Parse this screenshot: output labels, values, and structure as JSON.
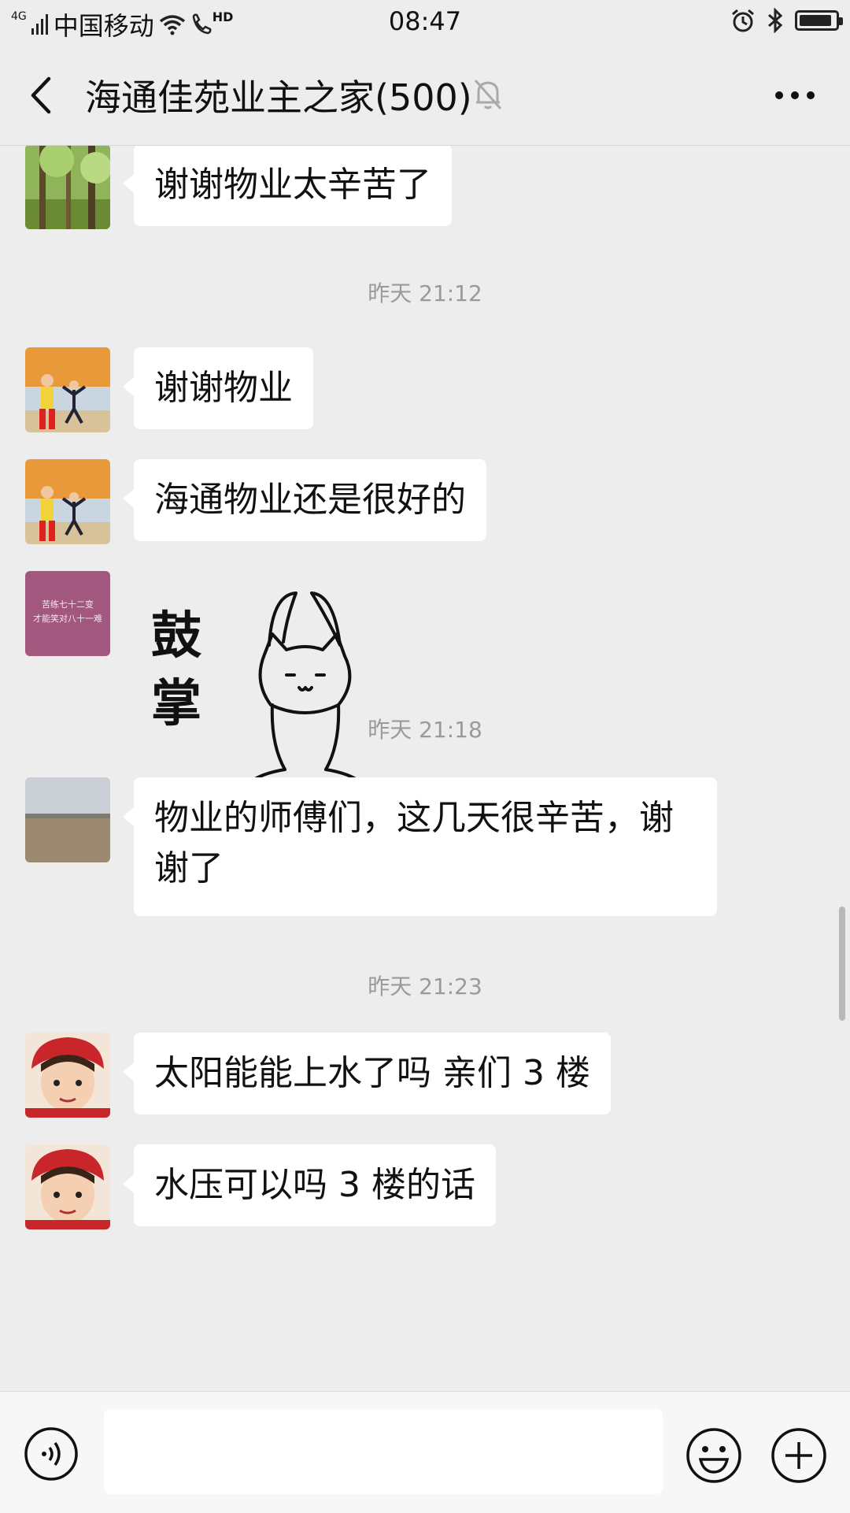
{
  "status_bar": {
    "signal": "4G",
    "carrier": "中国移动",
    "hd": "HD",
    "time": "08:47",
    "icons": [
      "signal-icon",
      "wifi-icon",
      "hd-call-icon",
      "alarm-icon",
      "bluetooth-icon",
      "battery-icon"
    ],
    "battery_level": 0.9
  },
  "nav": {
    "title": "海通佳苑业主之家(500)",
    "icons": [
      "back-arrow-icon",
      "mute-bell-icon",
      "more-dots-icon"
    ]
  },
  "messages": [
    {
      "type": "text",
      "avatar": "forest-avatar",
      "text": "谢谢物业太辛苦了"
    },
    {
      "type": "time",
      "text": "昨天 21:12"
    },
    {
      "type": "text",
      "avatar": "beach-kids-avatar",
      "text": "谢谢物业"
    },
    {
      "type": "text",
      "avatar": "beach-kids-avatar",
      "text": "海通物业还是很好的"
    },
    {
      "type": "sticker",
      "avatar": "purple-quote-avatar",
      "avatar_text": [
        "苦练七十二变",
        "才能笑对八十一难"
      ],
      "sticker_text": [
        "鼓",
        "掌"
      ]
    },
    {
      "type": "time",
      "text": "昨天 21:18"
    },
    {
      "type": "text",
      "avatar": "river-avatar",
      "text": "物业的师傅们，这几天很辛苦，谢谢了"
    },
    {
      "type": "time",
      "text": "昨天 21:23"
    },
    {
      "type": "text",
      "avatar": "child-red-hat-avatar",
      "text": "太阳能能上水了吗 亲们 3 楼"
    },
    {
      "type": "text",
      "avatar": "child-red-hat-avatar",
      "text": "水压可以吗 3 楼的话"
    }
  ],
  "input_bar": {
    "value": "",
    "icons": [
      "voice-icon",
      "emoji-icon",
      "plus-icon"
    ]
  }
}
